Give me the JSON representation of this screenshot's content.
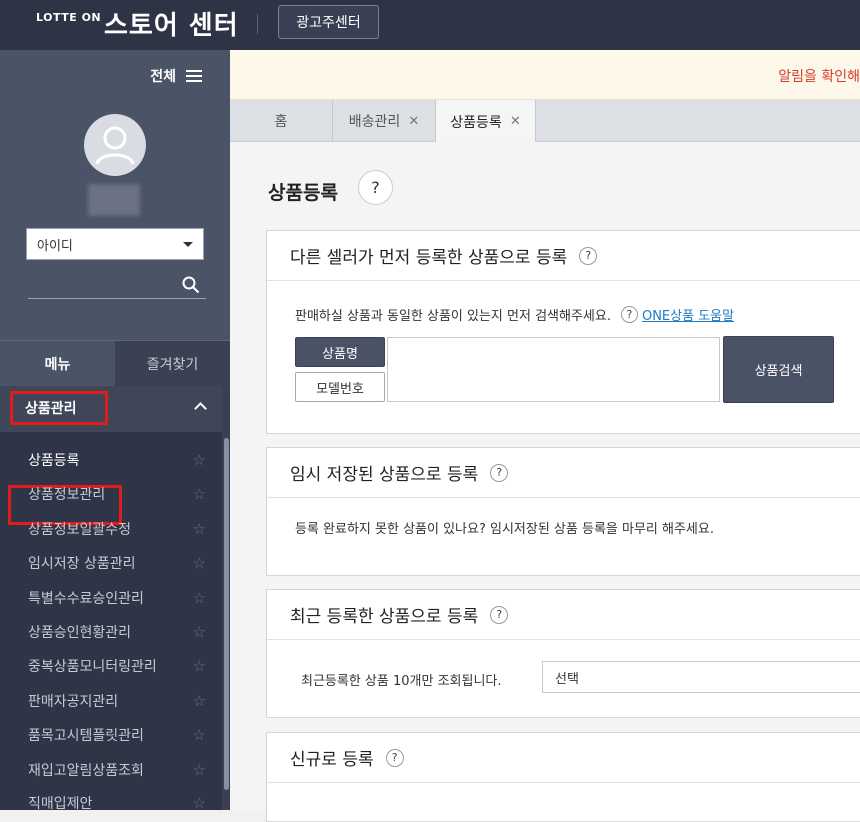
{
  "header": {
    "logo_small": "LOTTE ON",
    "logo_big": "스토어 센터",
    "advertiser_button": "광고주센터"
  },
  "sidebar": {
    "all_menu_label": "전체",
    "id_select_value": "아이디",
    "tabs": {
      "menu": "메뉴",
      "favorites": "즐겨찾기"
    },
    "section_title": "상품관리",
    "items": [
      {
        "label": "상품등록"
      },
      {
        "label": "상품정보관리"
      },
      {
        "label": "상품정보일괄수정"
      },
      {
        "label": "임시저장 상품관리"
      },
      {
        "label": "특별수수료승인관리"
      },
      {
        "label": "상품승인현황관리"
      },
      {
        "label": "중복상품모니터링관리"
      },
      {
        "label": "판매자공지관리"
      },
      {
        "label": "품목고시템플릿관리"
      },
      {
        "label": "재입고알림상품조회"
      },
      {
        "label": "직매입제안"
      }
    ]
  },
  "notice": {
    "text": "알림을 확인해"
  },
  "page_tabs": [
    {
      "label": "홈"
    },
    {
      "label": "배송관리"
    },
    {
      "label": "상품등록"
    }
  ],
  "main": {
    "title": "상품등록",
    "section1": {
      "title": "다른 셀러가 먼저 등록한 상품으로 등록",
      "instruction": "판매하실 상품과 동일한 상품이 있는지 먼저 검색해주세요.",
      "help_link": "ONE상품 도움말",
      "btn_product_name": "상품명",
      "btn_model_number": "모델번호",
      "btn_search": "상품검색"
    },
    "section2": {
      "title": "임시 저장된 상품으로 등록",
      "text": "등록 완료하지 못한 상품이 있나요? 임시저장된 상품 등록을 마무리 해주세요."
    },
    "section3": {
      "title": "최근 등록한 상품으로 등록",
      "text": "최근등록한 상품 10개만 조회됩니다.",
      "select_value": "선택"
    },
    "section4": {
      "title": "신규로 등록"
    }
  }
}
